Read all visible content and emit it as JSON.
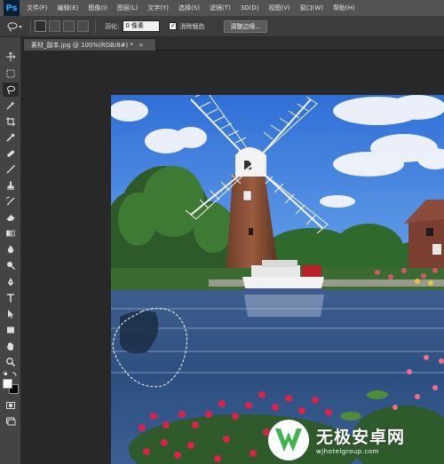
{
  "app": {
    "logo_text": "Ps"
  },
  "menu": [
    "文件(F)",
    "编辑(E)",
    "图像(I)",
    "图层(L)",
    "文字(Y)",
    "选择(S)",
    "滤镜(T)",
    "3D(D)",
    "视图(V)",
    "窗口(W)",
    "帮助(H)"
  ],
  "options": {
    "feather_label": "羽化:",
    "feather_value": "0 像素",
    "antialias_label": "消除锯齿",
    "antialias_checked": true,
    "refine_edge_label": "调整边缘..."
  },
  "document": {
    "tab_title": "素材_副本.jpg @ 100%(RGB/8#) *",
    "close_glyph": "×"
  },
  "tools": [
    "move-icon",
    "marquee-icon",
    "lasso-icon",
    "quick-select-icon",
    "crop-icon",
    "eyedropper-icon",
    "healing-brush-icon",
    "brush-icon",
    "clone-stamp-icon",
    "history-brush-icon",
    "eraser-icon",
    "gradient-icon",
    "blur-icon",
    "dodge-icon",
    "pen-icon",
    "type-icon",
    "path-select-icon",
    "shape-icon",
    "hand-icon",
    "zoom-icon"
  ],
  "colors": {
    "foreground": "#ffffff",
    "background": "#000000",
    "accent": "#31a8ff",
    "watermark_green": "#3fb34f"
  },
  "watermark": {
    "title": "无极安卓网",
    "url": "wjhotelgroup.com"
  }
}
